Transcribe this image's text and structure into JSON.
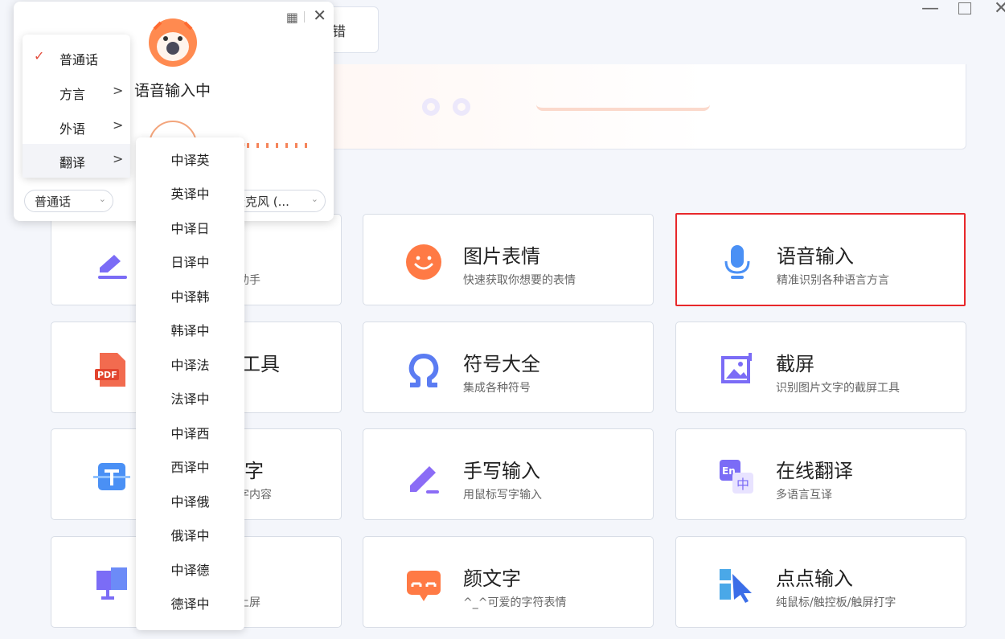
{
  "window": {
    "min": "—",
    "max": "□",
    "close": "✕"
  },
  "top_button": {
    "label": "错"
  },
  "cards": [
    {
      "title": "",
      "subtitle": "助手",
      "icon": "pen-tool-icon"
    },
    {
      "title": "图片表情",
      "subtitle": "快速获取你想要的表情",
      "icon": "smiley-icon"
    },
    {
      "title": "语音输入",
      "subtitle": "精准识别各种语言方言",
      "icon": "microphone-icon"
    },
    {
      "title": "工具",
      "subtitle": "",
      "icon": "pdf-icon"
    },
    {
      "title": "符号大全",
      "subtitle": "集成各种符号",
      "icon": "omega-icon"
    },
    {
      "title": "截屏",
      "subtitle": "识别图片文字的截屏工具",
      "icon": "screenshot-icon"
    },
    {
      "title": "字",
      "subtitle": "字内容",
      "icon": "text-scan-icon"
    },
    {
      "title": "手写输入",
      "subtitle": "用鼠标写字输入",
      "icon": "handwriting-icon"
    },
    {
      "title": "在线翻译",
      "subtitle": "多语言互译",
      "icon": "translate-icon"
    },
    {
      "title": "",
      "subtitle": "上屏",
      "icon": "screen-input-icon"
    },
    {
      "title": "颜文字",
      "subtitle": "^_^可爱的字符表情",
      "icon": "kaomoji-icon"
    },
    {
      "title": "点点输入",
      "subtitle": "纯鼠标/触控板/触屏打字",
      "icon": "click-input-icon"
    }
  ],
  "voice_panel": {
    "status": "语音输入中",
    "qr_icon": "qr-code-icon",
    "close": "✕",
    "language_select": "普通话",
    "mic_select": "麦克风 (..."
  },
  "lang_menu": {
    "items": [
      {
        "label": "普通话",
        "check": "✓",
        "arrow": ""
      },
      {
        "label": "方言",
        "check": "",
        "arrow": ">"
      },
      {
        "label": "外语",
        "check": "",
        "arrow": ">"
      },
      {
        "label": "翻译",
        "check": "",
        "arrow": ">"
      }
    ]
  },
  "translate_menu": {
    "items": [
      "中译英",
      "英译中",
      "中译日",
      "日译中",
      "中译韩",
      "韩译中",
      "中译法",
      "法译中",
      "中译西",
      "西译中",
      "中译俄",
      "俄译中",
      "中译德",
      "德译中"
    ]
  },
  "colors": {
    "accent": "#e8282b",
    "brand_orange": "#ff7a45",
    "purple": "#7b6cf6",
    "blue": "#4a90f5"
  }
}
